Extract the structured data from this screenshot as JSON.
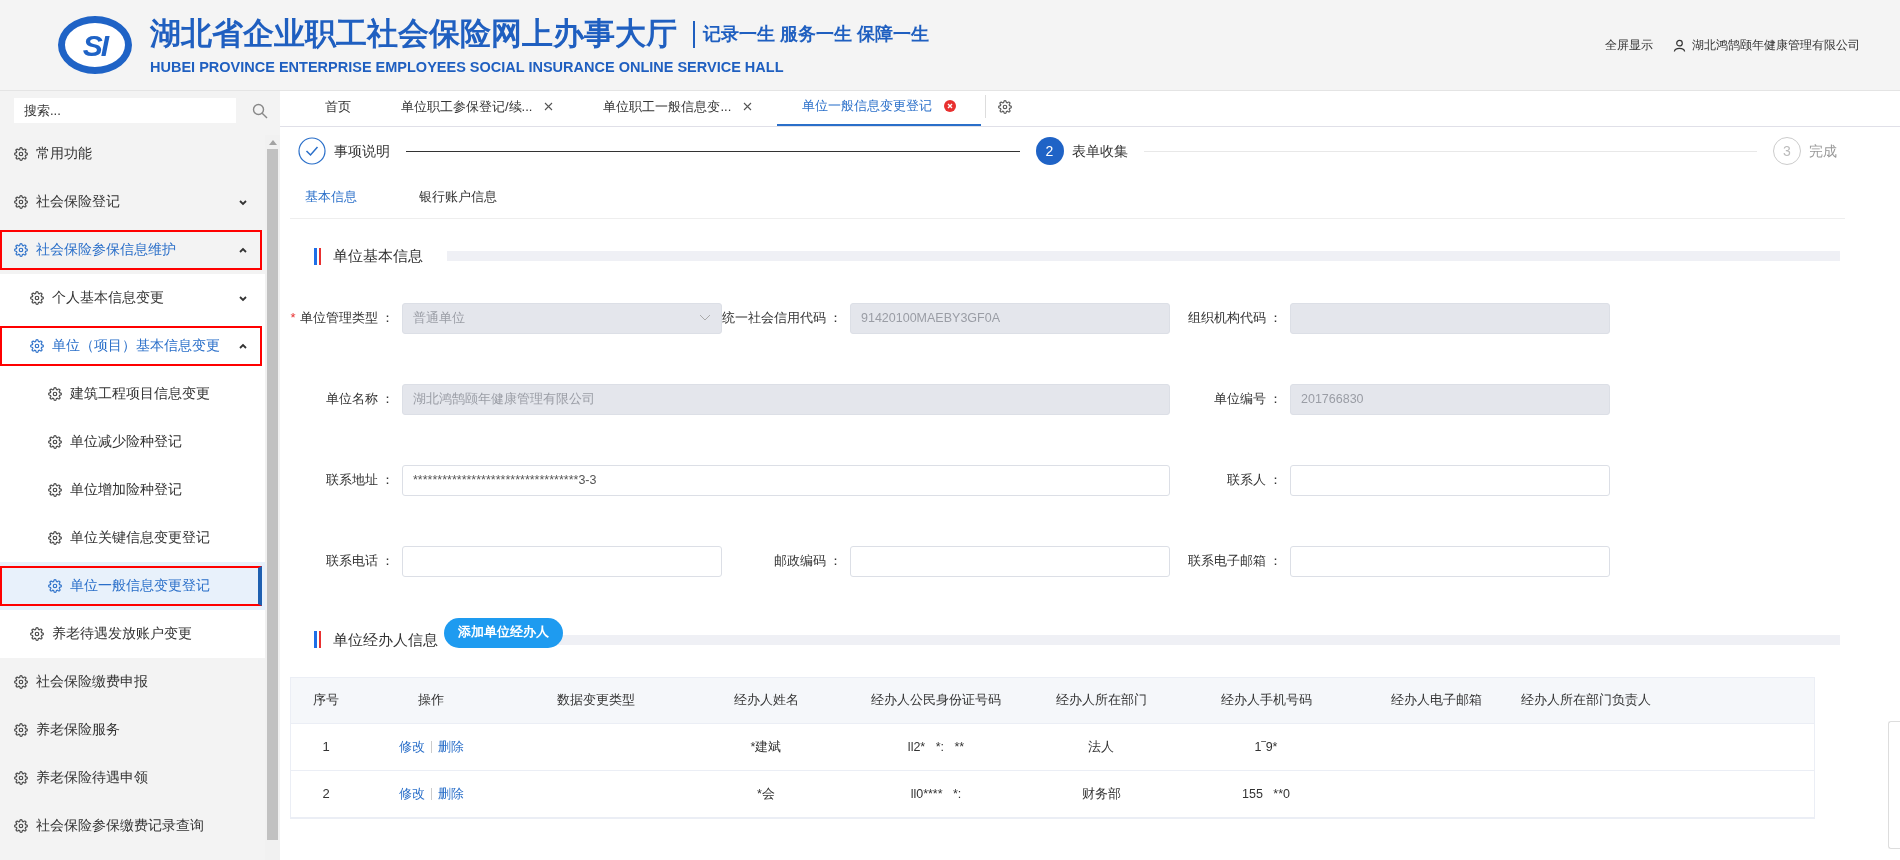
{
  "header": {
    "logo_text": "SI",
    "title": "湖北省企业职工社会保险网上办事大厅",
    "subtitle": "HUBEI PROVINCE ENTERPRISE EMPLOYEES SOCIAL INSURANCE ONLINE SERVICE HALL",
    "slogan": "记录一生 服务一生 保障一生",
    "fullscreen": "全屏显示",
    "user": "湖北鸿鹄颐年健康管理有限公司"
  },
  "sidebar": {
    "search_placeholder": "搜索...",
    "items": [
      {
        "label": "常用功能",
        "highlighted": false
      },
      {
        "label": "社会保险登记",
        "expanded": false,
        "highlighted": false
      },
      {
        "label": "社会保险参保信息维护",
        "expanded": true,
        "highlighted": true,
        "children": [
          {
            "label": "个人基本信息变更",
            "expanded": false,
            "highlighted": false
          },
          {
            "label": "单位（项目）基本信息变更",
            "expanded": true,
            "highlighted": true,
            "children": [
              {
                "label": "建筑工程项目信息变更",
                "selected": false,
                "highlighted": false
              },
              {
                "label": "单位减少险种登记",
                "selected": false,
                "highlighted": false
              },
              {
                "label": "单位增加险种登记",
                "selected": false,
                "highlighted": false
              },
              {
                "label": "单位关键信息变更登记",
                "selected": false,
                "highlighted": false
              },
              {
                "label": "单位一般信息变更登记",
                "selected": true,
                "highlighted": true
              }
            ]
          },
          {
            "label": "养老待遇发放账户变更",
            "highlighted": false
          }
        ]
      },
      {
        "label": "社会保险缴费申报",
        "highlighted": false
      },
      {
        "label": "养老保险服务",
        "highlighted": false
      },
      {
        "label": "养老保险待遇申领",
        "highlighted": false
      },
      {
        "label": "社会保险参保缴费记录查询",
        "highlighted": false
      }
    ]
  },
  "tabs": [
    {
      "label": "首页",
      "selected": false,
      "closable": false
    },
    {
      "label": "单位职工参保登记/续...",
      "selected": false,
      "closable": true
    },
    {
      "label": "单位职工一般信息变...",
      "selected": false,
      "closable": true
    },
    {
      "label": "单位一般信息变更登记",
      "selected": true,
      "closable": true
    }
  ],
  "steps": [
    {
      "label": "事项说明",
      "done": true
    },
    {
      "number": "2",
      "label": "表单收集",
      "done": false,
      "selected": true
    },
    {
      "number": "3",
      "label": "完成",
      "done": false,
      "selected": false
    }
  ],
  "subtabs": [
    {
      "label": "基本信息",
      "selected": true
    },
    {
      "label": "银行账户信息",
      "selected": false
    }
  ],
  "basic_section": {
    "title": "单位基本信息",
    "fields": [
      {
        "label": "单位管理类型 ：",
        "required_mark": "*",
        "kind": "select",
        "value": "普通单位",
        "disabled": true,
        "span": false
      },
      {
        "label": "统一社会信用代码 ：",
        "kind": "text",
        "value": "91420100MAEBY3GF0A",
        "disabled": true,
        "span": false
      },
      {
        "label": "组织机构代码 ：",
        "kind": "text",
        "disabled": true,
        "span": false
      },
      {
        "label": "单位名称 ：",
        "kind": "text",
        "value": "湖北鸿鹄颐年健康管理有限公司",
        "disabled": true,
        "span": true
      },
      {
        "label": "单位编号 ：",
        "kind": "text",
        "value": "201766830",
        "disabled": true,
        "span": false
      },
      {
        "label": "联系地址 ：",
        "kind": "text",
        "value": "**********************************3-3",
        "disabled": false,
        "span": true
      },
      {
        "label": "联系人 ：",
        "kind": "text",
        "disabled": false,
        "span": false
      },
      {
        "label": "联系电话 ：",
        "kind": "text",
        "disabled": false,
        "span": false
      },
      {
        "label": "邮政编码 ：",
        "kind": "text",
        "disabled": false,
        "span": false
      },
      {
        "label": "联系电子邮箱 ：",
        "kind": "text",
        "disabled": false,
        "span": false
      }
    ]
  },
  "agent_section": {
    "title": "单位经办人信息",
    "add_button": "添加单位经办人",
    "table": {
      "columns": [
        "序号",
        "操作",
        "数据变更类型",
        "经办人姓名",
        "经办人公民身份证号码",
        "经办人所在部门",
        "经办人手机号码",
        "经办人电子邮箱",
        "经办人所在部门负责人"
      ],
      "rows": [
        {
          "index": "1",
          "actions": [
            "修改",
            "删除"
          ],
          "name": "*建斌",
          "id_number": "ll2*   *:   **",
          "department": "法人",
          "phone": "1‾9*"
        },
        {
          "index": "2",
          "actions": [
            "修改",
            "删除"
          ],
          "name": "*会",
          "id_number": "ll0****   *:",
          "department": "财务部",
          "phone": "155   **0"
        }
      ]
    }
  }
}
